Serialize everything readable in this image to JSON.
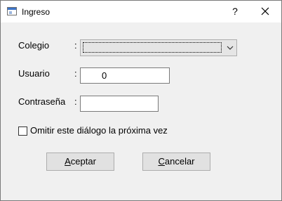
{
  "window": {
    "title": "Ingreso",
    "help_glyph": "?",
    "close_glyph": "×"
  },
  "form": {
    "colegio_label": "Colegio",
    "colegio_colon": ":",
    "colegio_value": "",
    "usuario_label": "Usuario",
    "usuario_colon": ":",
    "usuario_value": "0",
    "contrasena_label": "Contraseña",
    "contrasena_colon": ":",
    "contrasena_value": "",
    "skip_checkbox_label": "Omitir este diálogo la próxima vez",
    "skip_checked": false
  },
  "buttons": {
    "accept_label": "Aceptar",
    "cancel_label": "Cancelar"
  },
  "icons": {
    "app": "window-app-icon",
    "dropdown": "chevron-down-icon",
    "close": "close-icon"
  }
}
